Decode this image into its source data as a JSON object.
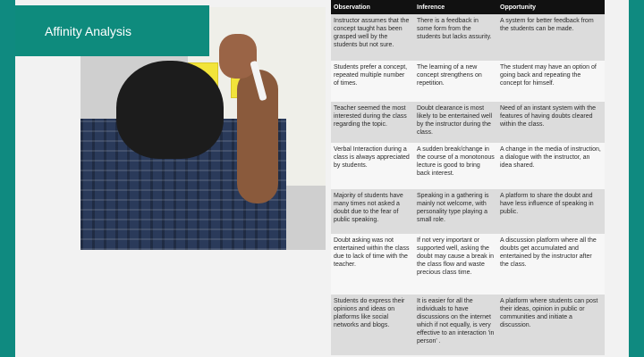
{
  "banner": {
    "title": "Affinity Analysis"
  },
  "table": {
    "headers": [
      "Observation",
      "Inference",
      "Opportunity"
    ],
    "rows": [
      [
        "Instructor assumes that the concept taught has been grasped well by the students but not sure.",
        "There is a feedback in some form from the students but lacks assurity.",
        "A system for better feedback from the students can be made."
      ],
      [
        "Students prefer a concept, repeated multiple number of times.",
        "The learning of a new concept strengthens on repetition.",
        "The student may have an option of going back and repeating the concept for himself."
      ],
      [
        "Teacher seemed the most interested during the class regarding the topic.",
        "Doubt clearance is most likely to be entertained well by the instructor during the class.",
        "Need of an instant system with the features of having doubts cleared within the class."
      ],
      [
        "Verbal Interaction during a class is always appreciated by students.",
        "A sudden break/change in the course of a monotonous lecture is good to bring back interest.",
        "A change in the media of instruction, a dialogue with the instructor, an idea shared."
      ],
      [
        "Majority of students have many times not asked a doubt due to the fear of public speaking.",
        "Speaking in a gathering is mainly not welcome, with personality type playing a small role.",
        "A platform to share the doubt and have less influence of speaking in public."
      ],
      [
        "Doubt asking was not entertained within the class due to lack of time with the teacher.",
        "If not very important or supported well, asking the doubt may cause a break in the class flow and waste precious class time.",
        "A discussion platform where all the doubts get accumulated and entertained by the instructor after the class."
      ],
      [
        "Students do express their opinions and ideas on platforms like social networks and blogs.",
        "It is easier for all the individuals to have discussions on the internet which if not equally, is very effective to an interaction 'in person' .",
        "A platform where students can post their ideas, opinion in public or communities and initiate a discussion."
      ]
    ]
  }
}
